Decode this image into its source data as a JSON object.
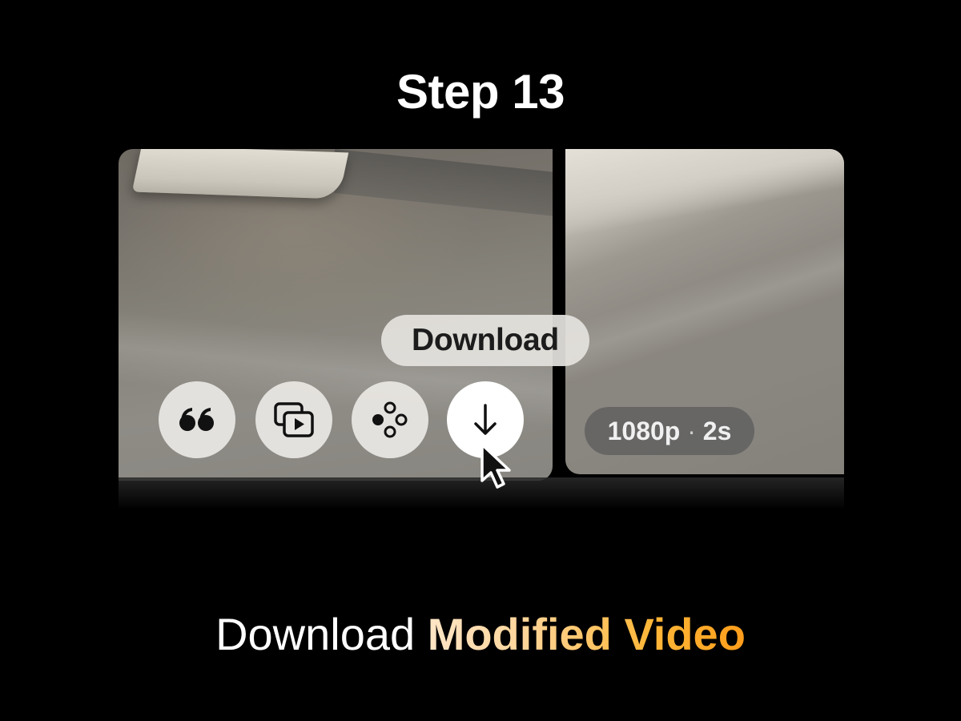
{
  "header": {
    "step_title": "Step 13"
  },
  "player": {
    "tooltip": "Download",
    "buttons": [
      {
        "name": "quote",
        "icon": "quote-icon"
      },
      {
        "name": "preview",
        "icon": "media-playlist-icon"
      },
      {
        "name": "effects",
        "icon": "circles-cluster-icon"
      },
      {
        "name": "download",
        "icon": "arrow-down-icon"
      }
    ],
    "badge": {
      "resolution": "1080p",
      "separator": "·",
      "duration": "2s"
    }
  },
  "caption": {
    "plain": "Download",
    "accent": "Modified Video"
  },
  "colors": {
    "background": "#000000",
    "accent_start": "#ffe6c7",
    "accent_end": "#ff9d1a"
  }
}
